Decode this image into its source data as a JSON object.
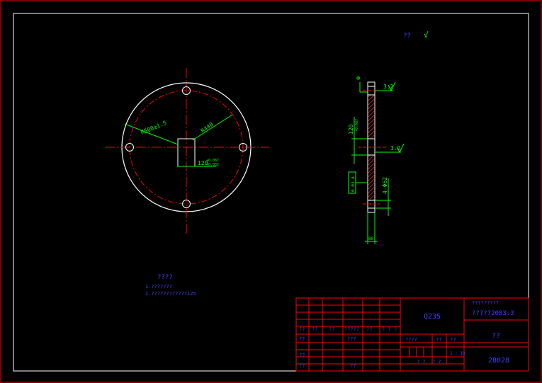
{
  "title_block": {
    "material": "Q235",
    "company_line1": "?????????",
    "company_line2": "?????2003.3",
    "part_name": "??",
    "drawing_number": "28028",
    "scale": "1 : 10",
    "rev_labels": [
      "??",
      "??",
      "??",
      "?????",
      "??",
      "? ?  ?"
    ],
    "left_labels": [
      "??",
      "???",
      "??",
      "??",
      "??"
    ],
    "sheet_labels": [
      "????",
      "??",
      "??"
    ],
    "bottom_mid": "? ?",
    "bottom_mid2": "? ?"
  },
  "front_view": {
    "dim_pitch_circle": "R500±1.5",
    "dim_radius": "R440",
    "dim_square": "120",
    "dim_square_tol_top": "+0.087",
    "dim_square_tol_bottom": "+0.032"
  },
  "side_view": {
    "symbol": "⊚",
    "roughness_top": "3.2",
    "roughness_mid": "3.2",
    "dim_top": "120",
    "dim_top_tol": "+0.087",
    "gdt_frame": "0.03 A",
    "dim_hole": "4-Φ62",
    "dim_thickness": "80"
  },
  "notes": {
    "title": "????",
    "line1": "1.???????",
    "line2": "2.????????????125"
  },
  "top_right": {
    "label": "??",
    "roughness_symbol": "√"
  }
}
